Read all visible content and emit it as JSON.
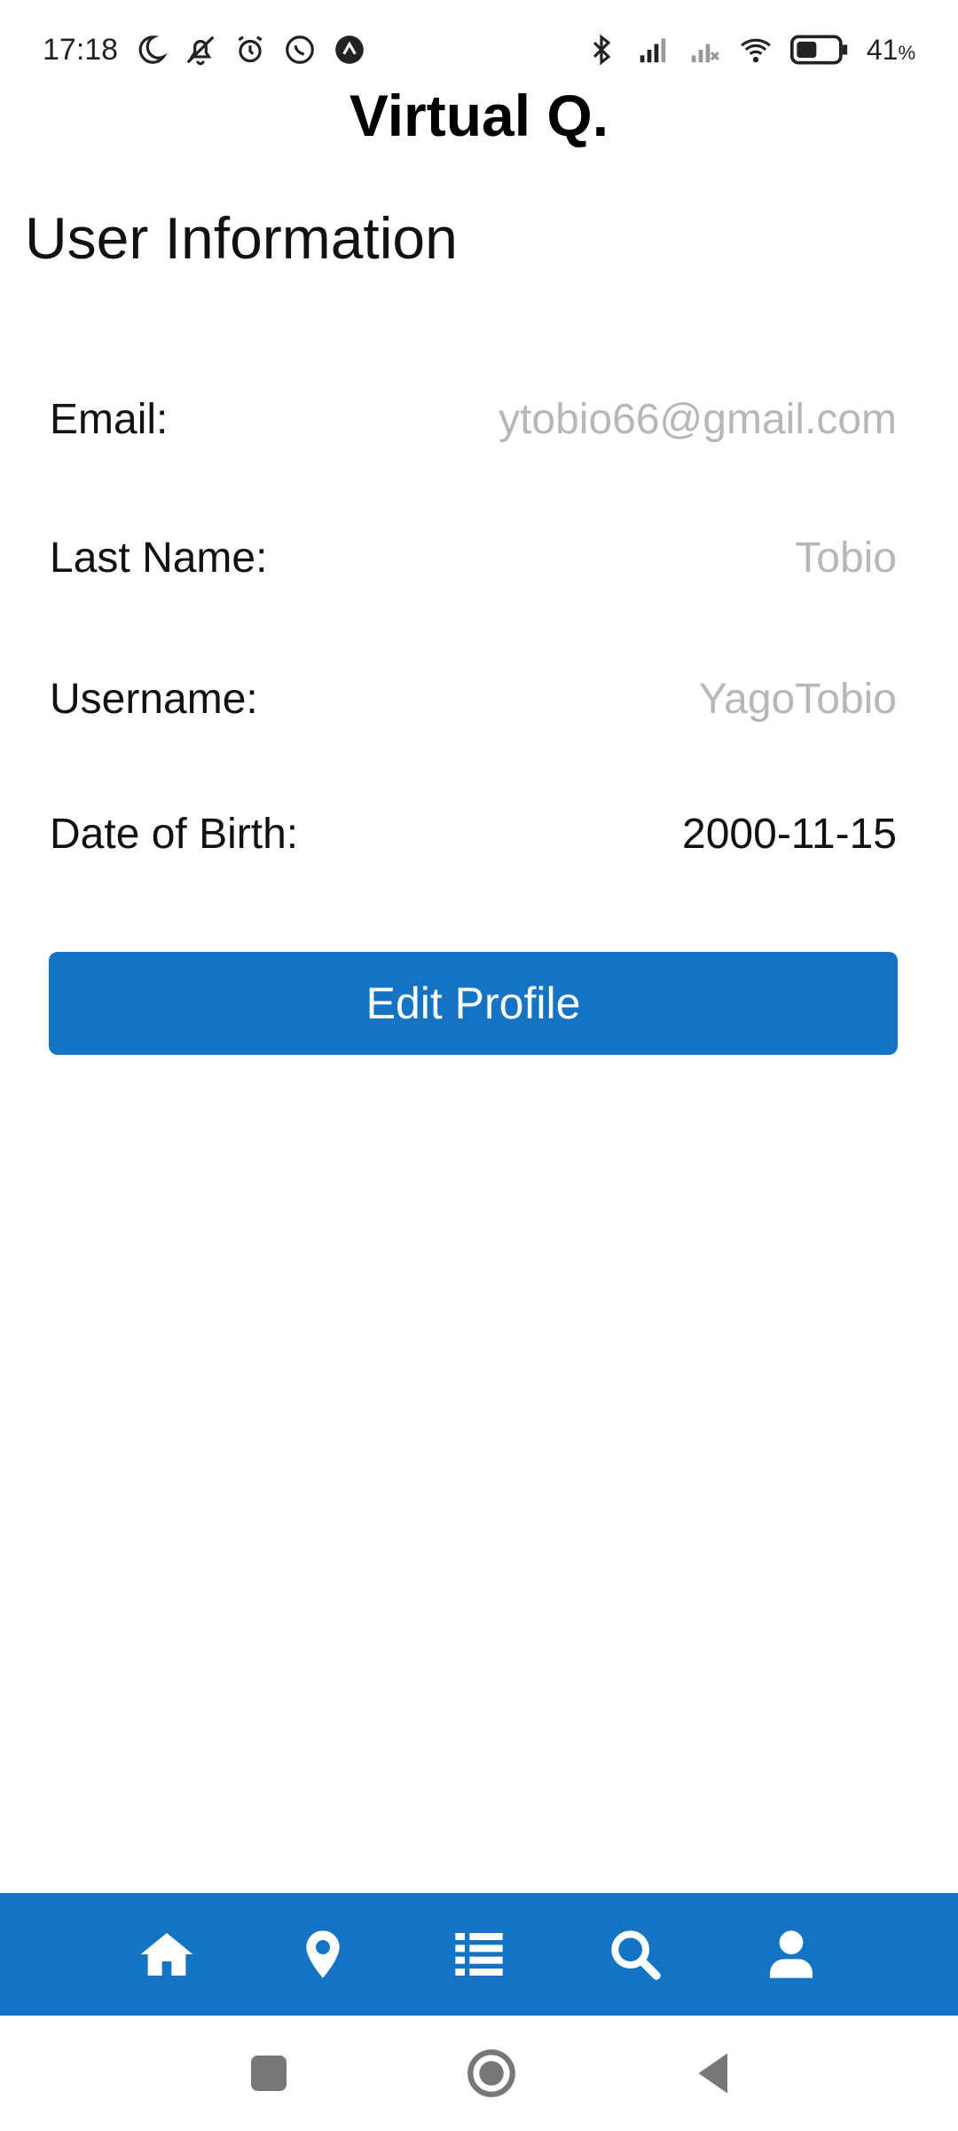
{
  "status_bar": {
    "time": "17:18",
    "battery": "41",
    "battery_unit": "%",
    "left_icons": [
      "moon-icon",
      "bell-off-icon",
      "alarm-icon",
      "whatsapp-icon",
      "app-arrow-icon"
    ],
    "right_icons": [
      "bluetooth-icon",
      "signal-icon",
      "signal-off-icon",
      "wifi-icon",
      "battery-icon"
    ]
  },
  "header": {
    "app_title": "Virtual Q."
  },
  "profile": {
    "section_title": "User Information",
    "fields": [
      {
        "label": "Email:",
        "value": "ytobio66@gmail.com"
      },
      {
        "label": "Last Name:",
        "value": "Tobio"
      },
      {
        "label": "Username:",
        "value": "YagoTobio"
      },
      {
        "label": "Date of Birth:",
        "value": "2000-11-15"
      }
    ],
    "edit_button_label": "Edit Profile"
  },
  "tab_bar": {
    "items": [
      "home-icon",
      "map-pin-icon",
      "list-icon",
      "search-icon",
      "user-icon"
    ],
    "color": "#1474c3"
  },
  "system_nav": {
    "buttons": [
      "recents-icon",
      "home-circle-icon",
      "back-icon"
    ]
  },
  "colors": {
    "accent": "#1474c3",
    "placeholder_text": "#b7b7b7"
  }
}
